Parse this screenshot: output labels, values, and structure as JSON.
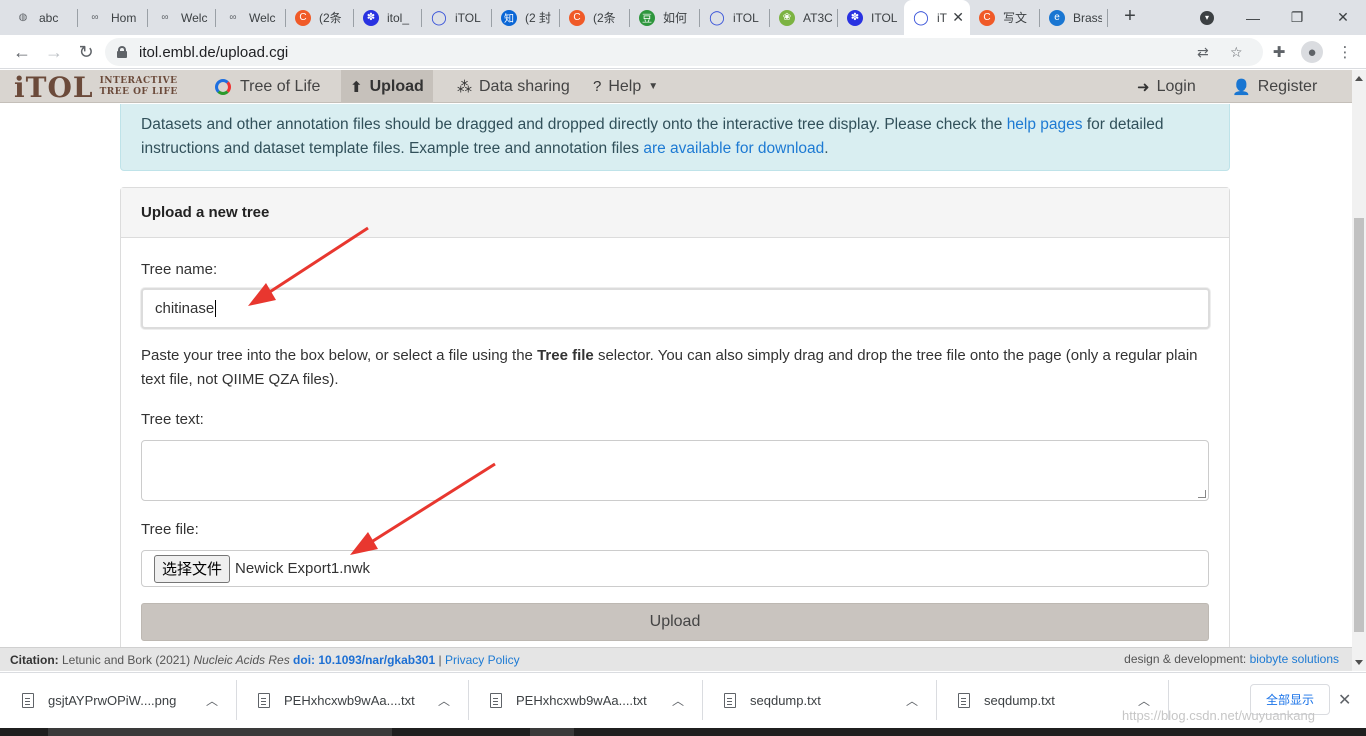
{
  "browser": {
    "tabs": [
      {
        "title": "abc",
        "icon": "globe-icon",
        "color": "#5f6368",
        "glyph": "◍"
      },
      {
        "title": "Hom",
        "icon": "link-icon",
        "color": "#5f6368",
        "glyph": "∞"
      },
      {
        "title": "Welc",
        "icon": "link-icon",
        "color": "#5f6368",
        "glyph": "∞"
      },
      {
        "title": "Welc",
        "icon": "link-icon",
        "color": "#5f6368",
        "glyph": "∞"
      },
      {
        "title": "(2条",
        "icon": "csdn-icon",
        "color": "#f05a28",
        "glyph": "C"
      },
      {
        "title": "itol_",
        "icon": "baidu-icon",
        "color": "#2932e1",
        "glyph": "✽"
      },
      {
        "title": "iTOL",
        "icon": "itol-icon",
        "color": "#3b55d9",
        "glyph": "◯"
      },
      {
        "title": "(2 封",
        "icon": "zhihu-icon",
        "color": "#0a66d6",
        "glyph": "知"
      },
      {
        "title": "(2条",
        "icon": "csdn-icon",
        "color": "#f05a28",
        "glyph": "C"
      },
      {
        "title": "如何",
        "icon": "douban-icon",
        "color": "#2e963d",
        "glyph": "豆"
      },
      {
        "title": "iTOL",
        "icon": "itol-icon",
        "color": "#3b55d9",
        "glyph": "◯"
      },
      {
        "title": "AT3C",
        "icon": "plant-icon",
        "color": "#7cb342",
        "glyph": "❀"
      },
      {
        "title": "ITOL",
        "icon": "baidu-icon",
        "color": "#2932e1",
        "glyph": "✽"
      },
      {
        "title": "iT",
        "icon": "itol-icon",
        "color": "#3b55d9",
        "glyph": "◯"
      },
      {
        "title": "写文",
        "icon": "csdn-icon",
        "color": "#f05a28",
        "glyph": "C"
      },
      {
        "title": "Brass",
        "icon": "ie-icon",
        "color": "#1976d2",
        "glyph": "e"
      }
    ],
    "url": "itol.embl.de/upload.cgi"
  },
  "itol_nav": {
    "logo_main": "iTOL",
    "logo_sub_1": "INTERACTIVE",
    "logo_sub_2": "TREE OF LIFE",
    "tree_of_life": "Tree of Life",
    "upload": "Upload",
    "data_sharing": "Data sharing",
    "help": "Help",
    "login": "Login",
    "register": "Register"
  },
  "info": {
    "text_1": "Datasets and other annotation files should be dragged and dropped directly onto the interactive tree display. Please check the ",
    "link_1": "help pages",
    "text_2": " for detailed instructions and dataset template files. Example tree and annotation files ",
    "link_2": "are available for download",
    "text_3": "."
  },
  "form": {
    "header": "Upload a new tree",
    "tree_name_label": "Tree name:",
    "tree_name_value": "chitinase",
    "paste_text_1": "Paste your tree into the box below, or select a file using the ",
    "paste_bold": "Tree file",
    "paste_text_2": " selector. You can also simply drag and drop the tree file onto the page (only a regular plain text file, not QIIME QZA files).",
    "tree_text_label": "Tree text:",
    "tree_file_label": "Tree file:",
    "choose_file": "选择文件",
    "file_name": "Newick Export1.nwk",
    "upload_button": "Upload"
  },
  "citation": {
    "label": "Citation:",
    "authors": "Letunic and Bork (2021)",
    "journal": "Nucleic Acids Res",
    "doi": "doi: 10.1093/nar/gkab301",
    "sep": "|",
    "privacy": "Privacy Policy",
    "design": "design & development:",
    "dev": "biobyte solutions"
  },
  "downloads": {
    "items": [
      "gsjtAYPrwOPiW....png",
      "PEHxhcxwb9wAa....txt",
      "PEHxhcxwb9wAa....txt",
      "seqdump.txt",
      "seqdump.txt"
    ],
    "show_all": "全部显示"
  },
  "watermark": "https://blog.csdn.net/wuyuankang",
  "colors": {
    "accent_red": "#e8372f",
    "link": "#1d7ad3",
    "nav_bg": "#d9d5d0"
  }
}
